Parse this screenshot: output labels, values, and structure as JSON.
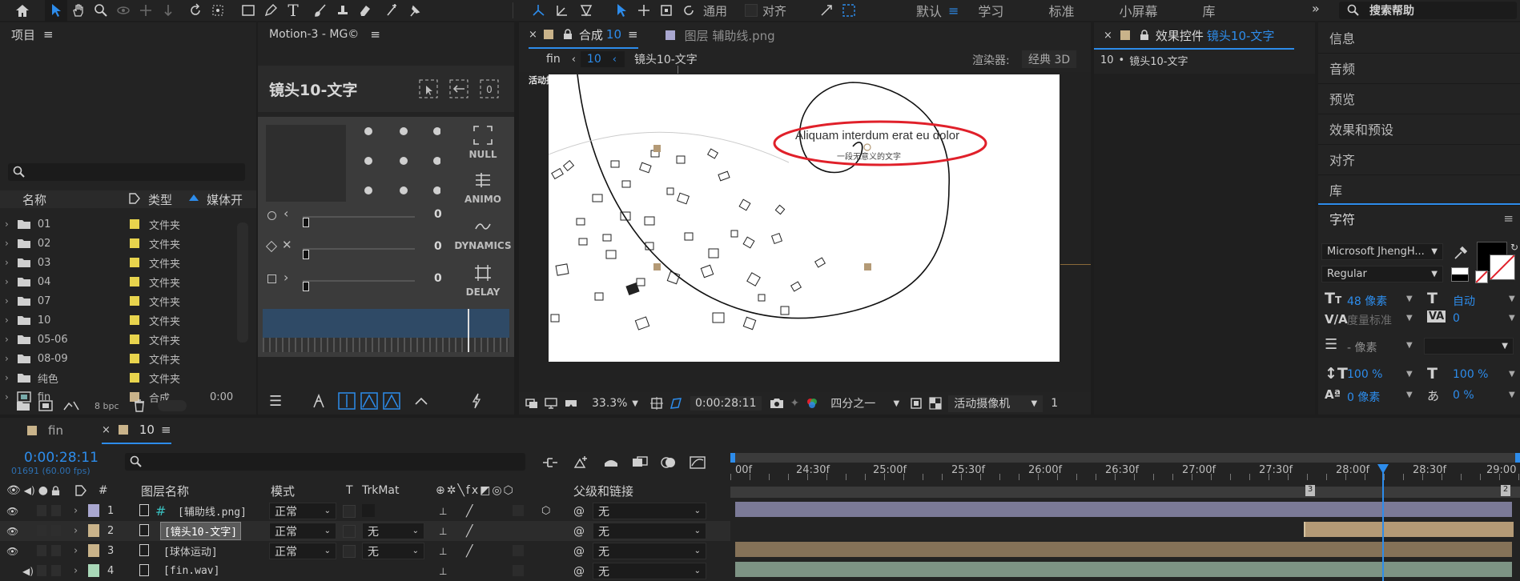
{
  "toolbar": {
    "checkbox_use": "通用",
    "checkbox_align": "对齐",
    "workspaces": [
      "默认",
      "学习",
      "标准",
      "小屏幕",
      "库"
    ],
    "search_placeholder": "搜索帮助"
  },
  "project": {
    "title": "项目",
    "columns": {
      "name": "名称",
      "type": "类型",
      "media": "媒体开"
    },
    "items": [
      {
        "name": "01",
        "type": "文件夹",
        "color": "#e8d44d"
      },
      {
        "name": "02",
        "type": "文件夹",
        "color": "#e8d44d"
      },
      {
        "name": "03",
        "type": "文件夹",
        "color": "#e8d44d"
      },
      {
        "name": "04",
        "type": "文件夹",
        "color": "#e8d44d"
      },
      {
        "name": "07",
        "type": "文件夹",
        "color": "#e8d44d"
      },
      {
        "name": "10",
        "type": "文件夹",
        "color": "#e8d44d"
      },
      {
        "name": "05-06",
        "type": "文件夹",
        "color": "#e8d44d"
      },
      {
        "name": "08-09",
        "type": "文件夹",
        "color": "#e8d44d"
      },
      {
        "name": "纯色",
        "type": "文件夹",
        "color": "#e8d44d"
      },
      {
        "name": "fin",
        "type": "合成",
        "media": "0:00",
        "color": "#c9b38a"
      }
    ],
    "bpc": "8 bpc"
  },
  "motion": {
    "tab": "Motion-3 - MG©",
    "layer_title": "镜头10-文字",
    "buttons": [
      "NULL",
      "ANIMO",
      "DYNAMICS",
      "DELAY"
    ],
    "slider_values": [
      "0",
      "0",
      "0"
    ]
  },
  "comp": {
    "tab_comp_label": "合成",
    "tab_comp_num": "10",
    "tab_layer": "图层 辅助线.png",
    "breadcrumb_fin": "fin",
    "breadcrumb_num": "10",
    "breadcrumb_name": "镜头10-文字",
    "renderer_label": "渲染器:",
    "renderer_value": "经典 3D",
    "active_camera": "活动摄像机",
    "canvas_text": "Aliquam interdum erat eu dolor",
    "canvas_subtext": "一段无意义的文字",
    "zoom": "33.3%",
    "timecode": "0:00:28:11",
    "resolution": "四分之一",
    "camera_view": "活动摄像机",
    "views": "1"
  },
  "effects": {
    "tab": "效果控件",
    "tab_layer": "镜头10-文字",
    "sub_num": "10",
    "sub_name": "镜头10-文字"
  },
  "right_panel": {
    "items": [
      "信息",
      "音频",
      "预览",
      "效果和预设",
      "对齐",
      "库"
    ],
    "character_title": "字符",
    "font": "Microsoft JhengH...",
    "style": "Regular",
    "size": "48 像素",
    "leading": "自动",
    "kerning": "度量标准",
    "tracking": "0",
    "stroke": "- 像素",
    "v_scale": "100 %",
    "h_scale": "100 %",
    "baseline": "0 像素",
    "tsume": "0 %"
  },
  "timeline": {
    "tab_fin": "fin",
    "tab_10": "10",
    "timecode": "0:00:28:11",
    "frames": "01691 (60.00 fps)",
    "columns": {
      "num": "#",
      "name": "图层名称",
      "mode": "模式",
      "t": "T",
      "trkmat": "TrkMat",
      "parent": "父级和链接"
    },
    "layers": [
      {
        "num": "1",
        "name": "[辅助线.png]",
        "mode": "正常",
        "trkmat": "",
        "parent": "无",
        "color": "#a9a7d0"
      },
      {
        "num": "2",
        "name": "[镜头10-文字]",
        "mode": "正常",
        "trkmat": "无",
        "parent": "无",
        "color": "#c9b38a"
      },
      {
        "num": "3",
        "name": "[球体运动]",
        "mode": "正常",
        "trkmat": "无",
        "parent": "无",
        "color": "#c9b38a"
      },
      {
        "num": "4",
        "name": "[fin.wav]",
        "mode": "",
        "trkmat": "",
        "parent": "无",
        "color": "#a9d8b8"
      }
    ],
    "ruler": [
      "00f",
      "24:30f",
      "25:00f",
      "25:30f",
      "26:00f",
      "26:30f",
      "27:00f",
      "27:30f",
      "28:00f",
      "28:30f",
      "29:00"
    ],
    "markers": [
      "3",
      "2"
    ]
  },
  "colors": {
    "accent": "#2d8ceb",
    "highlight_red": "#e0202a"
  }
}
